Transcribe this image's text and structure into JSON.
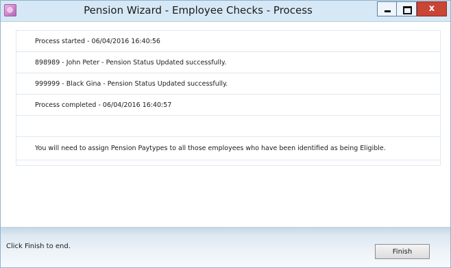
{
  "window": {
    "title": "Pension Wizard - Employee Checks - Process",
    "close_glyph": "x",
    "icon": "pension-wizard-app-icon"
  },
  "log": {
    "rows": [
      "Process started - 06/04/2016 16:40:56",
      "898989 - John Peter - Pension Status Updated successfully.",
      "999999 - Black Gina - Pension Status Updated successfully.",
      "Process completed - 06/04/2016 16:40:57",
      "",
      "You will need to assign Pension Paytypes to all those employees who have been identified as being Eligible."
    ]
  },
  "footer": {
    "instruction": "Click Finish to end.",
    "finish_label": "Finish"
  }
}
